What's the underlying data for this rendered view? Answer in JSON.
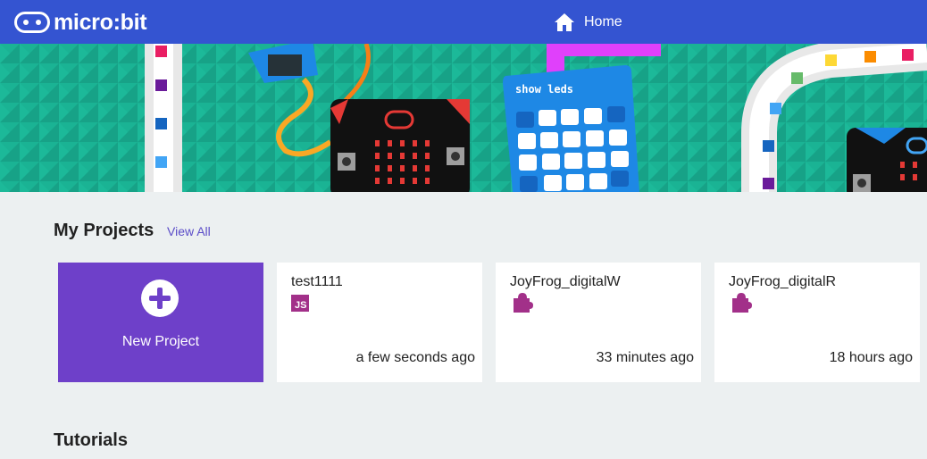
{
  "header": {
    "logo_text": "micro:bit",
    "home_label": "Home"
  },
  "projects": {
    "title": "My Projects",
    "view_all": "View All",
    "new_project_label": "New Project",
    "cards": [
      {
        "name": "test1111",
        "icon": "js-icon",
        "time": "a few seconds ago"
      },
      {
        "name": "JoyFrog_digitalW",
        "icon": "puzzle-icon",
        "time": "33 minutes ago"
      },
      {
        "name": "JoyFrog_digitalR",
        "icon": "puzzle-icon",
        "time": "18 hours ago"
      }
    ]
  },
  "tutorials": {
    "title": "Tutorials"
  },
  "hero": {
    "block_label": "show leds"
  },
  "colors": {
    "header": "#3454d1",
    "hero_bg": "#1ab394",
    "new_project": "#6e40c9",
    "js_badge": "#a23089",
    "link": "#5b4dc8"
  },
  "icons": {
    "js_badge_text": "JS"
  }
}
